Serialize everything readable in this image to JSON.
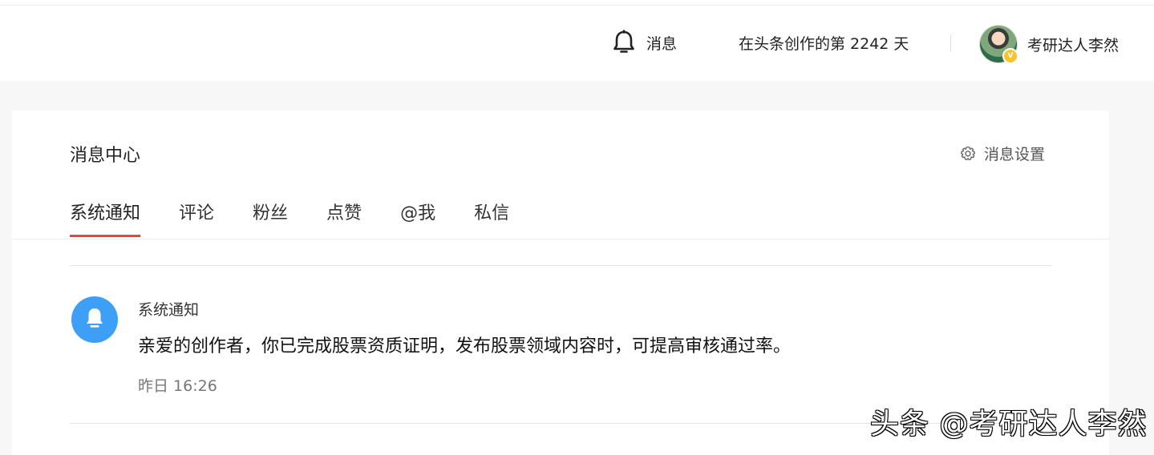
{
  "header": {
    "messages_label": "消息",
    "creation_days_text": "在头条创作的第 2242 天",
    "username": "考研达人李然",
    "verified_badge": "V"
  },
  "message_center": {
    "title": "消息中心",
    "settings_label": "消息设置",
    "tabs": [
      {
        "label": "系统通知",
        "active": true
      },
      {
        "label": "评论",
        "active": false
      },
      {
        "label": "粉丝",
        "active": false
      },
      {
        "label": "点赞",
        "active": false
      },
      {
        "label": "@我",
        "active": false
      },
      {
        "label": "私信",
        "active": false
      }
    ],
    "notifications": [
      {
        "source": "系统通知",
        "text": "亲爱的创作者，你已完成股票资质证明，发布股票领域内容时，可提高审核通过率。",
        "time": "昨日 16:26",
        "icon": "bell-icon"
      }
    ]
  },
  "watermark": "头条 @考研达人李然",
  "colors": {
    "accent_red": "#e8443a",
    "notice_icon_blue": "#3d9ff5",
    "page_bg": "#f7f7f7",
    "verified_yellow": "#f7c22d"
  }
}
